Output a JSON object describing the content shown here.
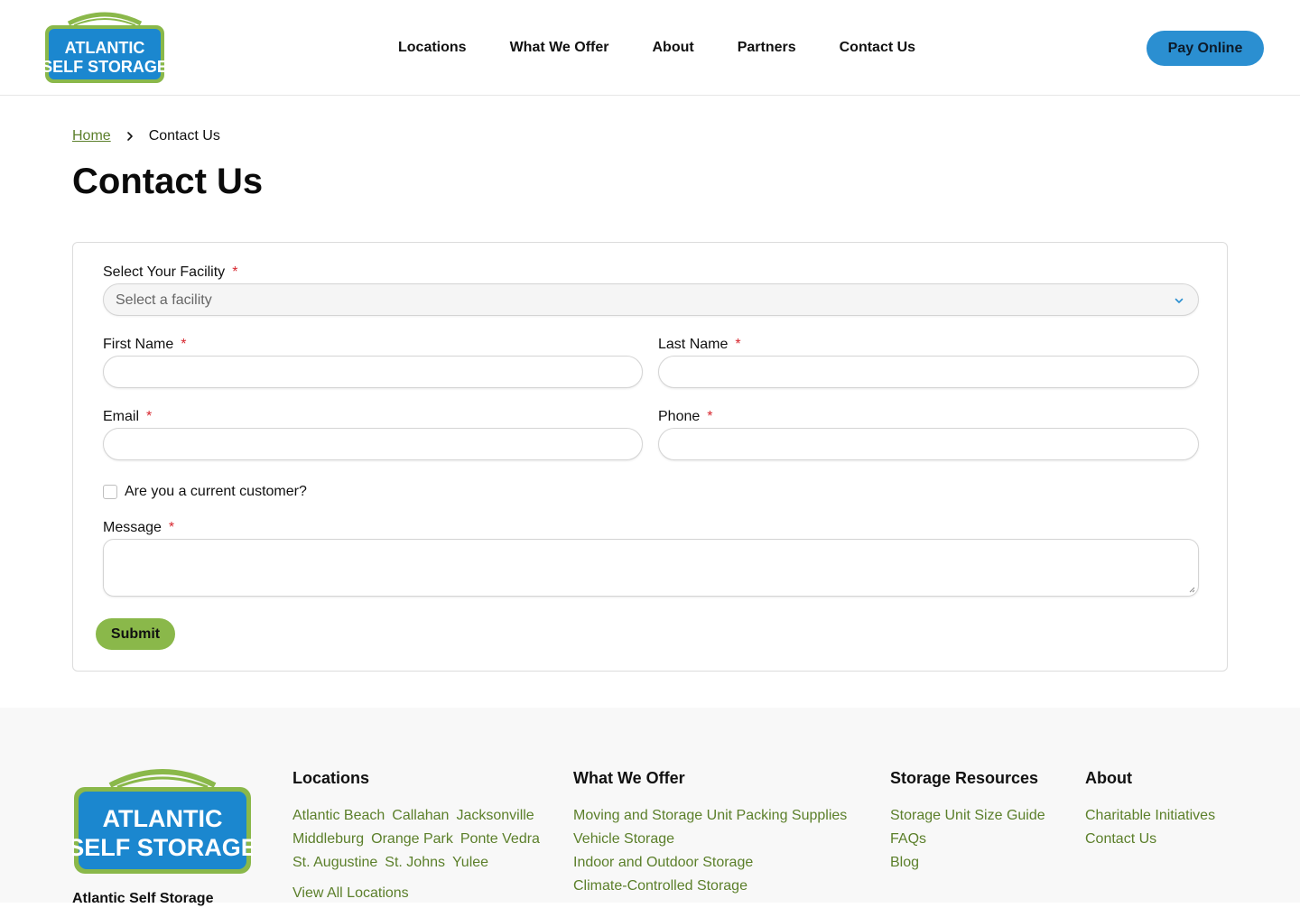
{
  "header": {
    "logo": {
      "line1": "ATLANTIC",
      "line2": "SELF STORAGE"
    },
    "nav": [
      {
        "label": "Locations"
      },
      {
        "label": "What We Offer"
      },
      {
        "label": "About"
      },
      {
        "label": "Partners"
      },
      {
        "label": "Contact Us"
      }
    ],
    "pay_label": "Pay Online"
  },
  "breadcrumb": {
    "home": "Home",
    "current": "Contact Us"
  },
  "page_title": "Contact Us",
  "form": {
    "facility_label": "Select Your Facility",
    "facility_placeholder": "Select a facility",
    "first_name_label": "First Name",
    "last_name_label": "Last Name",
    "email_label": "Email",
    "phone_label": "Phone",
    "customer_label": "Are you a current customer?",
    "message_label": "Message",
    "required_mark": "*",
    "submit_label": "Submit"
  },
  "footer": {
    "company": "Atlantic Self Storage",
    "locations": {
      "heading": "Locations",
      "rows": [
        [
          "Atlantic Beach",
          "Callahan",
          "Jacksonville"
        ],
        [
          "Middleburg",
          "Orange Park",
          "Ponte Vedra"
        ],
        [
          "St. Augustine",
          "St. Johns",
          "Yulee"
        ]
      ],
      "view_all": "View All Locations"
    },
    "offer": {
      "heading": "What We Offer",
      "links": [
        "Moving and Storage Unit Packing Supplies",
        "Vehicle Storage",
        "Indoor and Outdoor Storage",
        "Climate-Controlled Storage"
      ]
    },
    "resources": {
      "heading": "Storage Resources",
      "links": [
        "Storage Unit Size Guide",
        "FAQs",
        "Blog"
      ]
    },
    "about": {
      "heading": "About",
      "links": [
        "Charitable Initiatives",
        "Contact Us"
      ]
    }
  },
  "colors": {
    "brand_blue": "#2b8fd1",
    "brand_green": "#8ab84a",
    "link_green": "#5b7f2a",
    "required_red": "#d7262e"
  }
}
